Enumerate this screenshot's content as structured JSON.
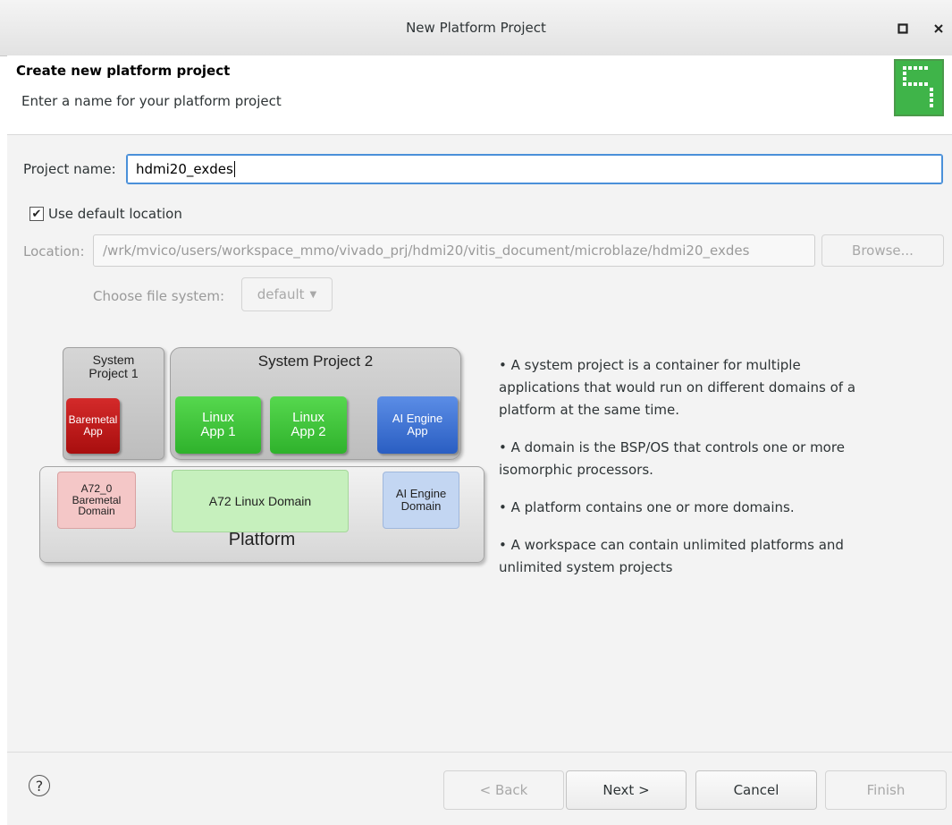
{
  "window": {
    "title": "New Platform Project",
    "maximize_icon": "maximize-icon",
    "close_icon": "close-icon"
  },
  "header": {
    "title": "Create new platform project",
    "description": "Enter a name for your platform project"
  },
  "form": {
    "project_name_label": "Project name:",
    "project_name_value": "hdmi20_exdes",
    "use_default_location_label": "Use default location",
    "use_default_location_checked": true,
    "location_label": "Location:",
    "location_value": "/wrk/mvico/users/workspace_mmo/vivado_prj/hdmi20/vitis_document/microblaze/hdmi20_exdes",
    "browse_label": "Browse...",
    "file_system_label": "Choose file system:",
    "file_system_value": "default"
  },
  "diagram": {
    "system_project_1": "System\nProject 1",
    "system_project_2": "System Project 2",
    "baremetal_app": "Baremetal\nApp",
    "linux_app_1": "Linux\nApp 1",
    "linux_app_2": "Linux\nApp 2",
    "ai_engine_app": "AI Engine\nApp",
    "baremetal_domain": "A72_0\nBaremetal\nDomain",
    "linux_domain": "A72 Linux Domain",
    "ai_engine_domain": "AI Engine\nDomain",
    "platform": "Platform"
  },
  "info_bullets": [
    "• A system project is a container for multiple applications that would run on different domains of a platform at the same time.",
    "• A domain is the BSP/OS that controls one or more isomorphic processors.",
    "• A platform contains one or more domains.",
    "• A workspace can contain unlimited platforms and unlimited system projects"
  ],
  "footer": {
    "help_icon": "?",
    "back_label": "< Back",
    "next_label": "Next >",
    "cancel_label": "Cancel",
    "finish_label": "Finish"
  }
}
